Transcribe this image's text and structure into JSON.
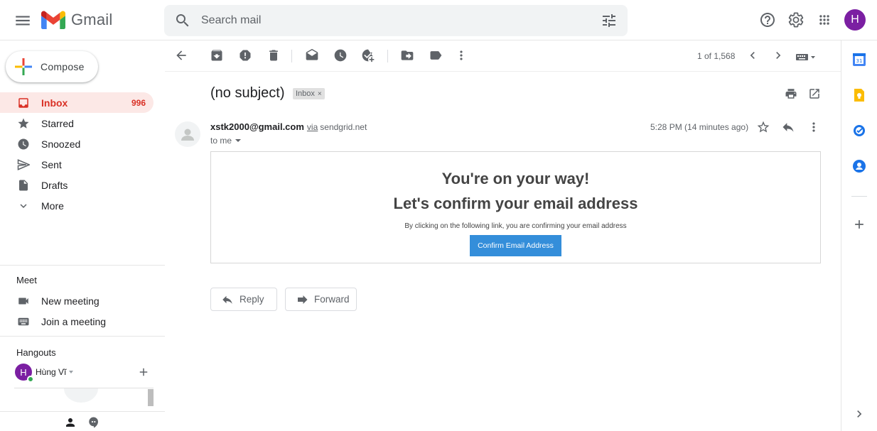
{
  "app": {
    "name": "Gmail"
  },
  "search": {
    "placeholder": "Search mail"
  },
  "account": {
    "initial": "H"
  },
  "sidebar": {
    "compose_label": "Compose",
    "items": [
      {
        "label": "Inbox",
        "count": "996",
        "icon": "inbox-icon",
        "active": true
      },
      {
        "label": "Starred",
        "count": "",
        "icon": "star-icon"
      },
      {
        "label": "Snoozed",
        "count": "",
        "icon": "clock-icon"
      },
      {
        "label": "Sent",
        "count": "",
        "icon": "send-icon"
      },
      {
        "label": "Drafts",
        "count": "",
        "icon": "draft-icon"
      },
      {
        "label": "More",
        "count": "",
        "icon": "chevron-down-icon"
      }
    ],
    "meet": {
      "title": "Meet",
      "new_meeting": "New meeting",
      "join_meeting": "Join a meeting"
    },
    "hangouts": {
      "title": "Hangouts",
      "user_initial": "H",
      "user_name": "Hùng Vĩ"
    }
  },
  "toolbar": {
    "pager": "1 of 1,568"
  },
  "email": {
    "subject": "(no subject)",
    "label": "Inbox",
    "label_remove": "×",
    "sender_email": "xstk2000@gmail.com",
    "via": "via",
    "via_domain": "sendgrid.net",
    "recipient": "to me",
    "time": "5:28 PM (14 minutes ago)",
    "body": {
      "heading1": "You're on your way!",
      "heading2": "Let's confirm your email address",
      "text": "By clicking on the following link, you are confirming your email address",
      "button": "Confirm Email Address"
    }
  },
  "actions": {
    "reply": "Reply",
    "forward": "Forward"
  },
  "colors": {
    "accent_red": "#d93025",
    "active_bg": "#fce8e6",
    "avatar_purple": "#7b1fa2",
    "confirm_button": "#348eda"
  }
}
